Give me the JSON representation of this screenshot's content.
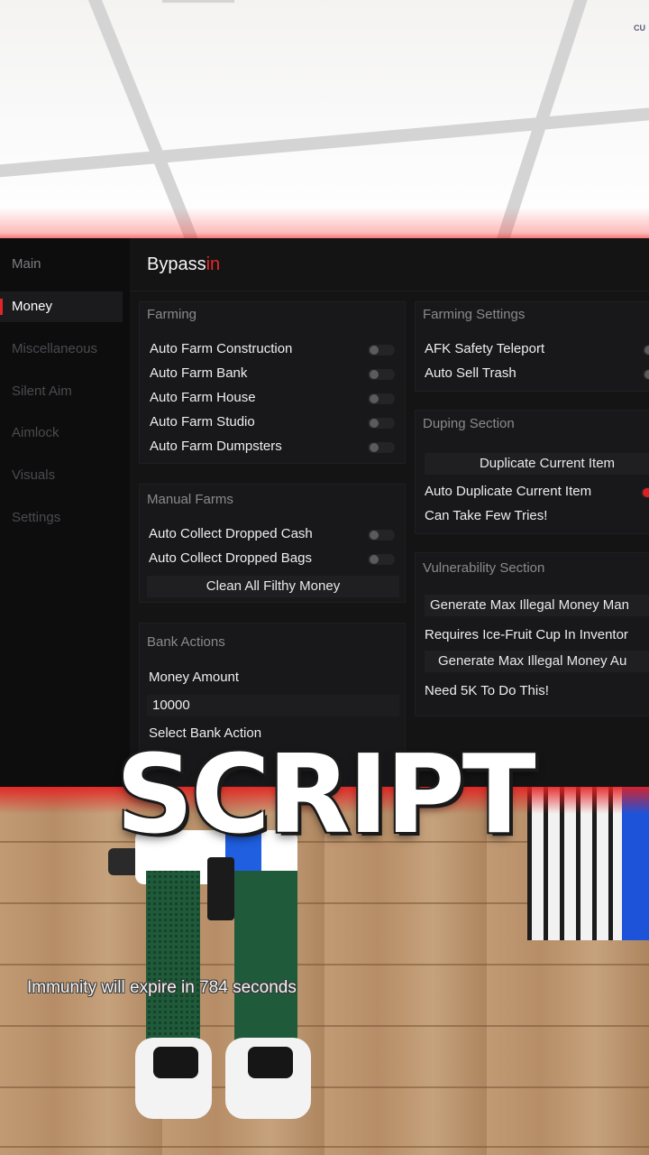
{
  "scene": {
    "badge": "CU",
    "overlay_title": "SCRIPT",
    "immunity_message": "Immunity will expire in 784 seconds"
  },
  "sidebar": {
    "items": [
      {
        "label": "Main",
        "state": "normal"
      },
      {
        "label": "Money",
        "state": "active"
      },
      {
        "label": "Miscellaneous",
        "state": "dim"
      },
      {
        "label": "Silent Aim",
        "state": "dim"
      },
      {
        "label": "Aimlock",
        "state": "dim"
      },
      {
        "label": "Visuals",
        "state": "dim"
      },
      {
        "label": "Settings",
        "state": "dim"
      }
    ]
  },
  "header": {
    "brand_main": "Bypass",
    "brand_accent": "in"
  },
  "farming": {
    "title": "Farming",
    "items": [
      {
        "label": "Auto Farm Construction",
        "enabled": false
      },
      {
        "label": "Auto Farm Bank",
        "enabled": false
      },
      {
        "label": "Auto Farm House",
        "enabled": false
      },
      {
        "label": "Auto Farm Studio",
        "enabled": false
      },
      {
        "label": "Auto Farm Dumpsters",
        "enabled": false
      }
    ]
  },
  "manual_farms": {
    "title": "Manual Farms",
    "items": [
      {
        "label": "Auto Collect Dropped Cash",
        "enabled": false
      },
      {
        "label": "Auto Collect Dropped Bags",
        "enabled": false
      }
    ],
    "button": "Clean All Filthy Money"
  },
  "bank_actions": {
    "title": "Bank Actions",
    "amount_label": "Money Amount",
    "amount_value": "10000",
    "action_label": "Select Bank Action"
  },
  "farming_settings": {
    "title": "Farming Settings",
    "items": [
      {
        "label": "AFK Safety Teleport",
        "enabled": false
      },
      {
        "label": "Auto Sell Trash",
        "enabled": false
      }
    ]
  },
  "duping": {
    "title": "Duping Section",
    "button": "Duplicate Current Item",
    "toggle_label": "Auto Duplicate Current Item",
    "toggle_enabled": true,
    "note": "Can Take Few Tries!"
  },
  "vulnerability": {
    "title": "Vulnerability Section",
    "button1": "Generate Max Illegal Money Man",
    "note1": "Requires Ice-Fruit Cup In Inventor",
    "button2": "Generate Max Illegal Money Au",
    "note2": "Need 5K To Do This!"
  },
  "colors": {
    "accent": "#e02626",
    "panel_bg": "#141415",
    "sidebar_bg": "#0d0d0e"
  }
}
